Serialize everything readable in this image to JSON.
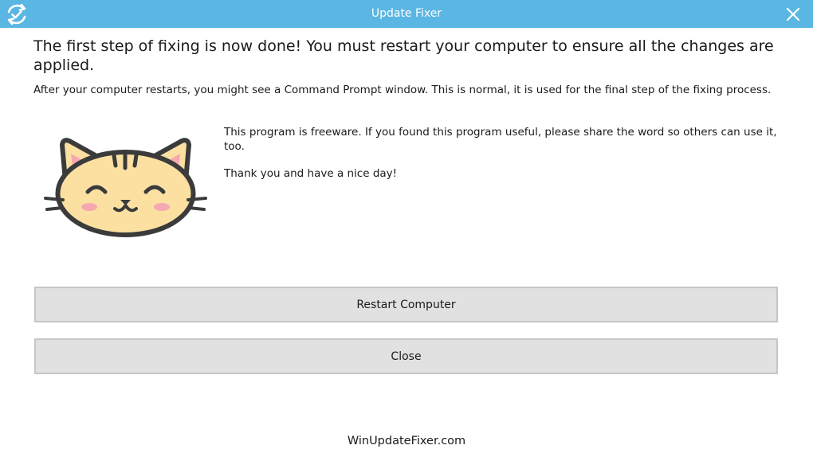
{
  "window": {
    "title": "Update Fixer",
    "titlebar_color": "#5ab6e3"
  },
  "main": {
    "headline": "The first step of fixing is now done! You must restart your computer to ensure all the changes are applied.",
    "restart_note": "After your computer restarts, you might see a Command Prompt window. This is normal, it is used for the final step of the fixing process.",
    "freeware_note": "This program is freeware. If you found this program useful, please share the word so others can use it, too.",
    "thanks": "Thank you and have a nice day!",
    "mascot_icon": "smiling-cat-icon"
  },
  "buttons": {
    "restart_label": "Restart Computer",
    "close_label": "Close"
  },
  "footer": {
    "site": "WinUpdateFixer.com"
  },
  "icons": {
    "app": "sync-check-icon",
    "close": "close-icon"
  }
}
